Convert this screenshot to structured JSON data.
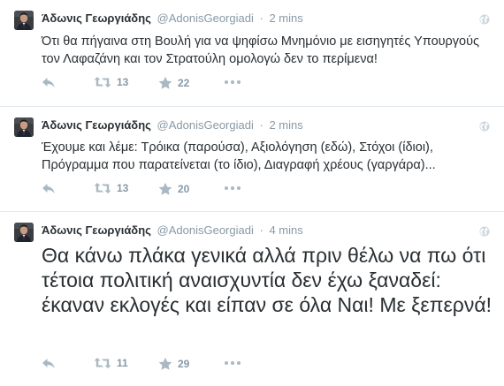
{
  "colors": {
    "text": "#292f33",
    "muted": "#8899a6",
    "border": "#e1e8ed"
  },
  "tweets": [
    {
      "fullname": "Άδωνις Γεωργιάδης",
      "username": "@AdonisGeorgiadi",
      "separator": "·",
      "time": "2 mins",
      "text": "Ότι θα πήγαινα στη Βουλή για να ψηφίσω Μνημόνιο με εισηγητές Υπουργούς τον Λαφαζάνη και τον Στρατούλη ομολογώ δεν το περίμενα!",
      "retweets": "13",
      "favorites": "22"
    },
    {
      "fullname": "Άδωνις Γεωργιάδης",
      "username": "@AdonisGeorgiadi",
      "separator": "·",
      "time": "2 mins",
      "text": "Έχουμε και λέμε: Τρόικα (παρούσα), Αξιολόγηση (εδώ), Στόχοι (ίδιοι), Πρόγραμμα που παρατείνεται (το ίδιο), Διαγραφή χρέους (γαργάρα)...",
      "retweets": "13",
      "favorites": "20"
    },
    {
      "fullname": "Άδωνις Γεωργιάδης",
      "username": "@AdonisGeorgiadi",
      "separator": "·",
      "time": "4 mins",
      "text": "Θα κάνω πλάκα γενικά αλλά πριν θέλω να πω ότι τέτοια πολιτική αναισχυντία δεν έχω ξαναδεί: έκαναν εκλογές και είπαν σε όλα Ναι! Με ξεπερνά!",
      "retweets": "11",
      "favorites": "29"
    }
  ],
  "icons": {
    "avatar": "avatar",
    "globe": "globe-icon",
    "reply": "reply-icon",
    "retweet": "retweet-icon",
    "favorite": "star-icon",
    "more": "more-dots-icon"
  }
}
